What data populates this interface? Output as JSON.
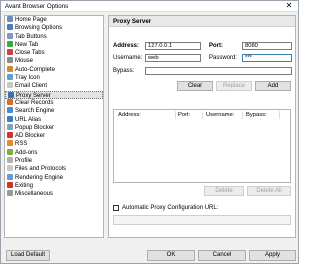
{
  "window": {
    "title": "Avant Browser Options",
    "close_glyph": "✕"
  },
  "tree": {
    "items": [
      {
        "label": "Home Page",
        "icon": "home-icon",
        "color": "#6a8fbf"
      },
      {
        "label": "Browsing Options",
        "icon": "browsing-icon",
        "color": "#4a7bbf"
      },
      {
        "label": "Tab Buttons",
        "icon": "tab-buttons-icon",
        "color": "#7a9ac0"
      },
      {
        "label": "New Tab",
        "icon": "new-tab-icon",
        "color": "#3cab3c"
      },
      {
        "label": "Close Tabs",
        "icon": "close-tabs-icon",
        "color": "#d04040"
      },
      {
        "label": "Mouse",
        "icon": "mouse-icon",
        "color": "#8a8a8a"
      },
      {
        "label": "Auto-Complete",
        "icon": "auto-complete-icon",
        "color": "#d08a30"
      },
      {
        "label": "Tray Icon",
        "icon": "tray-icon",
        "color": "#5aa0d8"
      },
      {
        "label": "Email Client",
        "icon": "email-icon",
        "color": "#c8c8c8"
      },
      {
        "label": "Proxy Server",
        "icon": "proxy-server-icon",
        "color": "#3f6fb0"
      },
      {
        "label": "Clear Records",
        "icon": "clear-records-icon",
        "color": "#d86a2a"
      },
      {
        "label": "Search Engine",
        "icon": "search-engine-icon",
        "color": "#4a8ad0"
      },
      {
        "label": "URL Alias",
        "icon": "url-alias-icon",
        "color": "#3a7ad0"
      },
      {
        "label": "Popup Blocker",
        "icon": "popup-blocker-icon",
        "color": "#8aa0b8"
      },
      {
        "label": "AD Blocker",
        "icon": "ad-blocker-icon",
        "color": "#d03030"
      },
      {
        "label": "RSS",
        "icon": "rss-icon",
        "color": "#f08a20"
      },
      {
        "label": "Add-ons",
        "icon": "add-ons-icon",
        "color": "#7ab040"
      },
      {
        "label": "Profile",
        "icon": "profile-icon",
        "color": "#b0b0b0"
      },
      {
        "label": "Files and Protocols",
        "icon": "files-icon",
        "color": "#c8c8c8"
      },
      {
        "label": "Rendering Engine",
        "icon": "rendering-engine-icon",
        "color": "#6a9ad0"
      },
      {
        "label": "Exiting",
        "icon": "exiting-icon",
        "color": "#d03030"
      },
      {
        "label": "Miscellaneous",
        "icon": "misc-icon",
        "color": "#9a9a9a"
      }
    ],
    "selected_index": 9
  },
  "panel": {
    "title": "Proxy Server",
    "address_label": "Address:",
    "address_value": "127.0.0.1",
    "port_label": "Port:",
    "port_value": "8080",
    "username_label": "Username:",
    "username_value": "web",
    "password_label": "Password:",
    "password_value": "***",
    "bypass_label": "Bypass:",
    "bypass_value": "",
    "clear_button": "Clear",
    "replace_button": "Replace",
    "add_button": "Add",
    "list_columns": [
      "Address:",
      "Port:",
      "Username:",
      "Bypass:"
    ],
    "delete_button": "Delete",
    "delete_all_button": "Delete All",
    "auto_config_label": "Automatic Proxy Configuration URL:",
    "auto_config_checked": false,
    "auto_config_value": ""
  },
  "footer": {
    "load_default": "Load Default",
    "ok": "OK",
    "cancel": "Cancel",
    "apply": "Apply"
  }
}
